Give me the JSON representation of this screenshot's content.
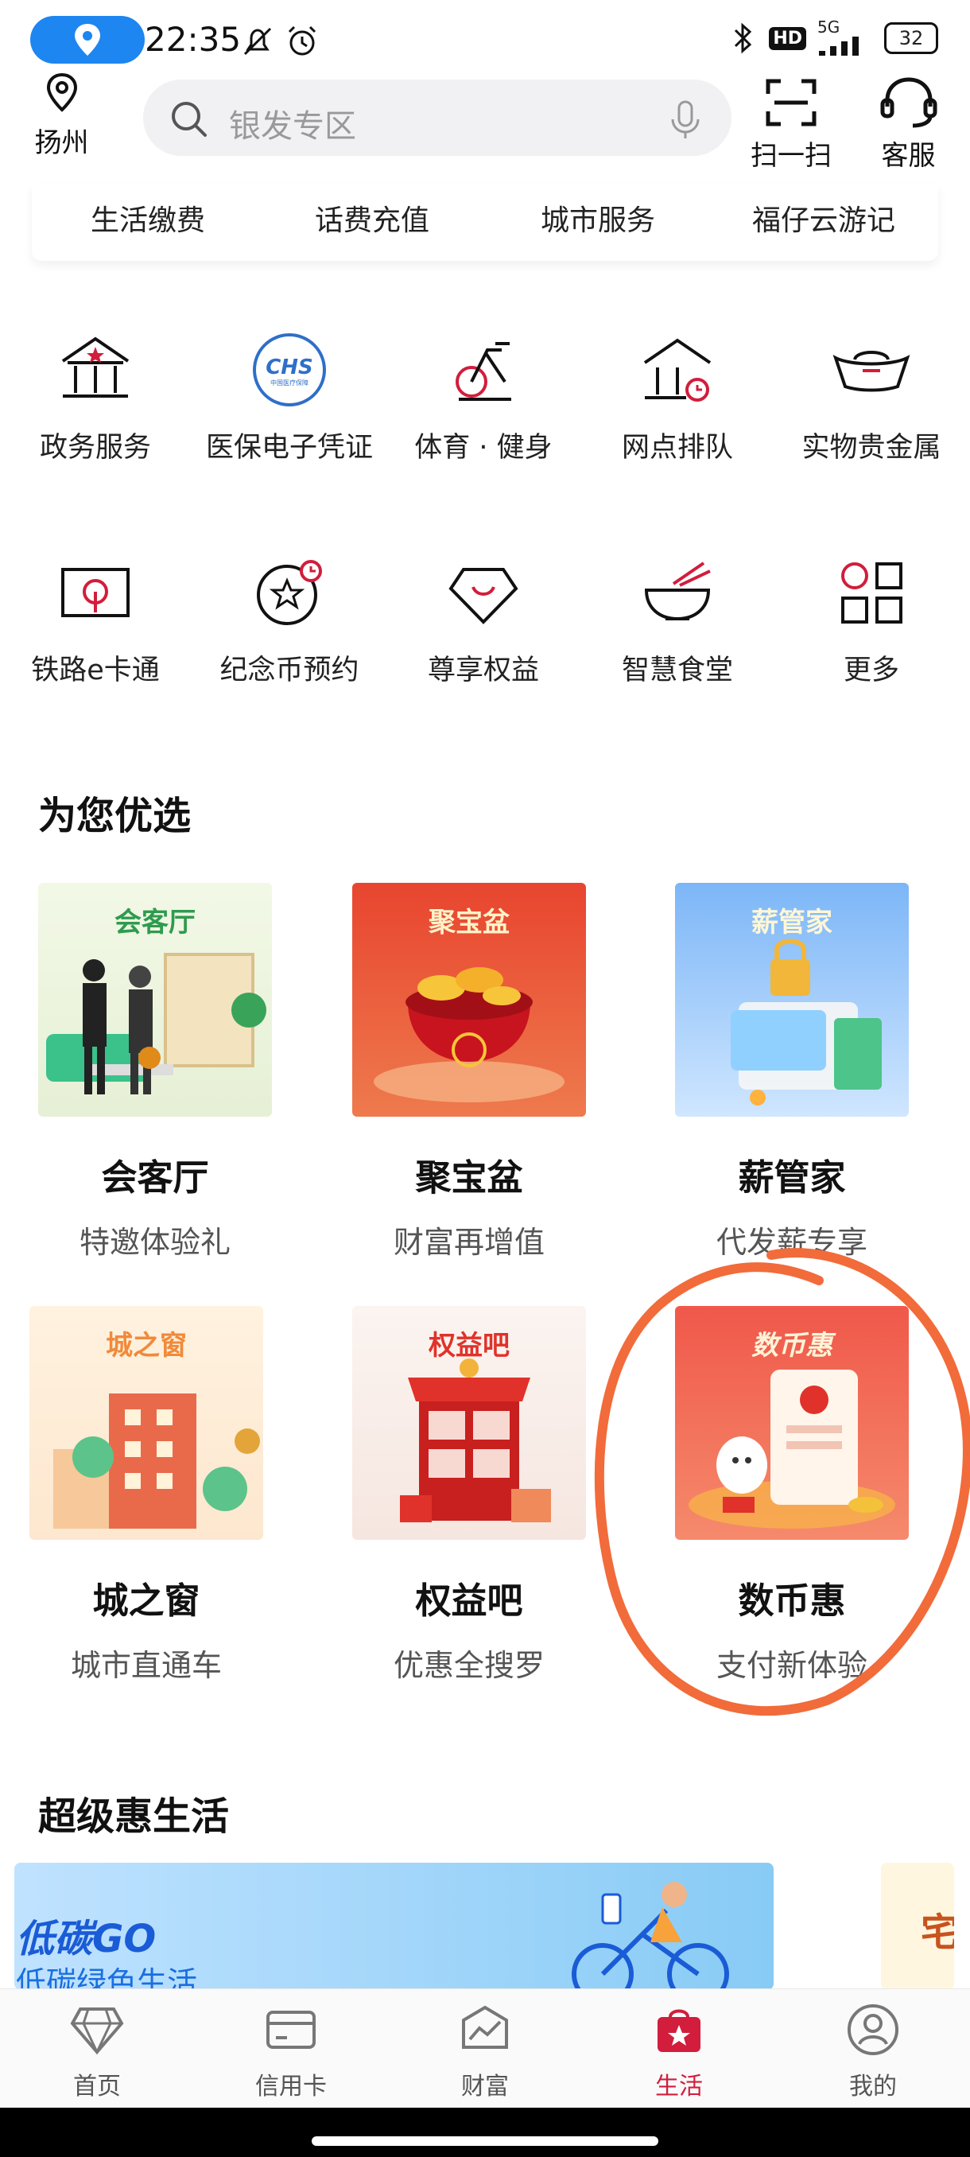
{
  "status_bar": {
    "time": "22:35",
    "network": "5G",
    "hd": "HD",
    "battery": "32"
  },
  "header": {
    "city": "扬州",
    "search_placeholder": "银发专区",
    "scan_label": "扫一扫",
    "service_label": "客服"
  },
  "quick_tabs": [
    "生活缴费",
    "话费充值",
    "城市服务",
    "福仔云游记"
  ],
  "services": [
    {
      "label": "政务服务",
      "icon": "government-building-icon"
    },
    {
      "label": "医保电子凭证",
      "icon": "chs-medical-insurance-icon"
    },
    {
      "label": "体育 · 健身",
      "icon": "exercise-bike-icon"
    },
    {
      "label": "网点排队",
      "icon": "branch-queue-icon"
    },
    {
      "label": "实物贵金属",
      "icon": "gold-ingot-icon"
    },
    {
      "label": "铁路e卡通",
      "icon": "railway-card-icon"
    },
    {
      "label": "纪念币预约",
      "icon": "commemorative-coin-icon"
    },
    {
      "label": "尊享权益",
      "icon": "diamond-benefit-icon"
    },
    {
      "label": "智慧食堂",
      "icon": "bowl-chopsticks-icon"
    },
    {
      "label": "更多",
      "icon": "more-grid-icon"
    }
  ],
  "icon_text": {
    "chs": "CHS",
    "chs_sub": "中国医疗保障"
  },
  "picks_title": "为您优选",
  "picks": [
    {
      "image_text": "会客厅",
      "title": "会客厅",
      "subtitle": "特邀体验礼"
    },
    {
      "image_text": "聚宝盆",
      "title": "聚宝盆",
      "subtitle": "财富再增值"
    },
    {
      "image_text": "薪管家",
      "title": "薪管家",
      "subtitle": "代发薪专享"
    },
    {
      "image_text": "城之窗",
      "title": "城之窗",
      "subtitle": "城市直通车"
    },
    {
      "image_text": "权益吧",
      "title": "权益吧",
      "subtitle": "优惠全搜罗"
    },
    {
      "image_text": "数币惠",
      "title": "数币惠",
      "subtitle": "支付新体验"
    }
  ],
  "super_title": "超级惠生活",
  "banner": {
    "title": "低碳GO",
    "subtitle": "低碳绿色生活",
    "side_text": "宅"
  },
  "tabs": [
    {
      "label": "首页",
      "icon": "diamond-home-icon"
    },
    {
      "label": "信用卡",
      "icon": "credit-card-icon"
    },
    {
      "label": "财富",
      "icon": "wealth-chart-icon"
    },
    {
      "label": "生活",
      "icon": "shopping-bag-star-icon"
    },
    {
      "label": "我的",
      "icon": "user-profile-icon"
    }
  ],
  "colors": {
    "accent": "#d21d3c",
    "annotation": "#f26b3a",
    "status_pill": "#1d86f0"
  }
}
